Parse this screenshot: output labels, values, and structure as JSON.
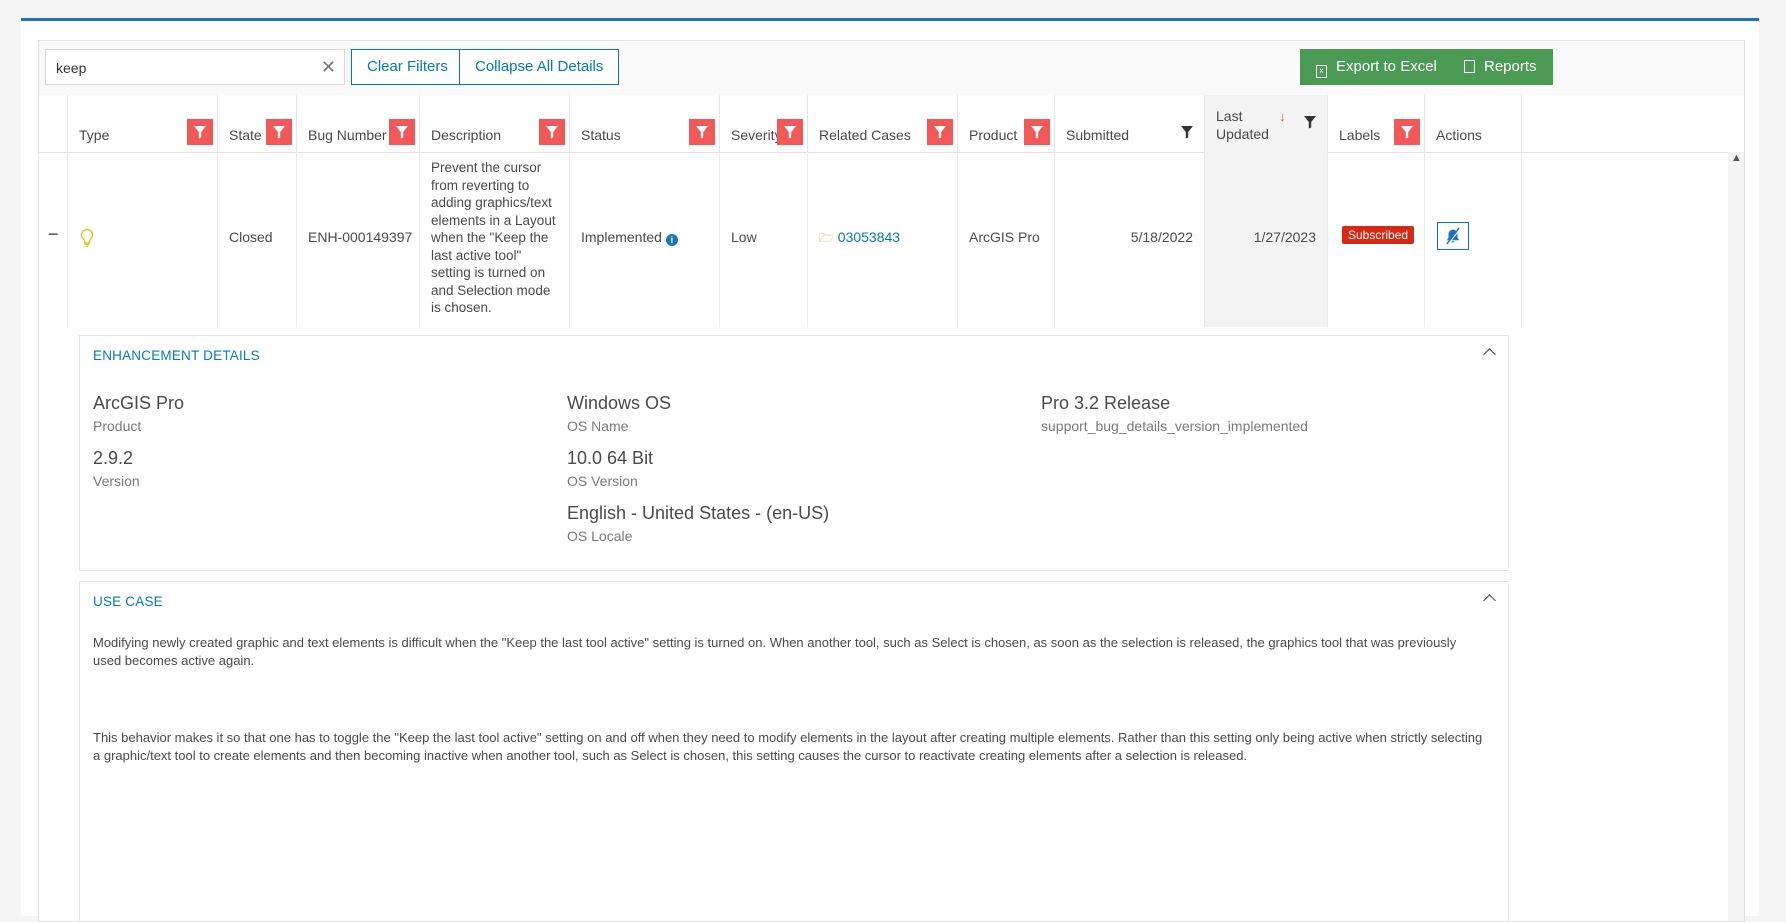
{
  "toolbar": {
    "search_value": "keep",
    "clear_icon": "close-icon",
    "clear_filters": "Clear Filters",
    "collapse_all": "Collapse All Details",
    "export": "Export to Excel",
    "reports": "Reports"
  },
  "columns": {
    "type": "Type",
    "state": "State",
    "bug_number": "Bug Number",
    "description": "Description",
    "status": "Status",
    "severity": "Severity",
    "related_cases": "Related Cases",
    "product": "Product",
    "submitted": "Submitted",
    "last_updated_1": "Last",
    "last_updated_2": "Updated",
    "labels": "Labels",
    "actions": "Actions"
  },
  "row": {
    "expand": "−",
    "type_icon": "lightbulb-icon",
    "state": "Closed",
    "bug_number": "ENH-000149397",
    "description": "Prevent the cursor from reverting to adding graphics/text elements in a Layout when the \"Keep the last active tool\" setting is turned on and Selection mode is chosen.",
    "status": "Implemented",
    "severity": "Low",
    "related_case": "03053843",
    "product": "ArcGIS Pro",
    "submitted": "5/18/2022",
    "last_updated": "1/27/2023",
    "label": "Subscribed"
  },
  "details": {
    "title": "ENHANCEMENT DETAILS",
    "product_value": "ArcGIS Pro",
    "product_label": "Product",
    "version_value": "2.9.2",
    "version_label": "Version",
    "os_value": "Windows OS",
    "os_label": "OS Name",
    "osver_value": "10.0 64 Bit",
    "osver_label": "OS Version",
    "locale_value": "English - United States - (en-US)",
    "locale_label": "OS Locale",
    "release_value": "Pro 3.2 Release",
    "release_label": "support_bug_details_version_implemented"
  },
  "use_case": {
    "title": "USE CASE",
    "p1": "Modifying newly created graphic and text elements is difficult when the \"Keep the last tool active\" setting is turned on. When another tool, such as Select is chosen, as soon as the selection is released, the graphics tool that was previously used becomes active again.",
    "p2": "This behavior makes it so that one has to toggle the \"Keep the last tool active\" setting on and off when they need to modify elements in the layout after creating multiple elements. Rather than this setting only being active when strictly selecting a graphic/text tool to create elements and then becoming inactive when another tool, such as Select is chosen, this setting causes the cursor to reactivate creating elements after a selection is released."
  },
  "colors": {
    "accent": "#007ac2",
    "filter": "#f25858",
    "green": "#4a9a54",
    "badge": "#d72915"
  }
}
